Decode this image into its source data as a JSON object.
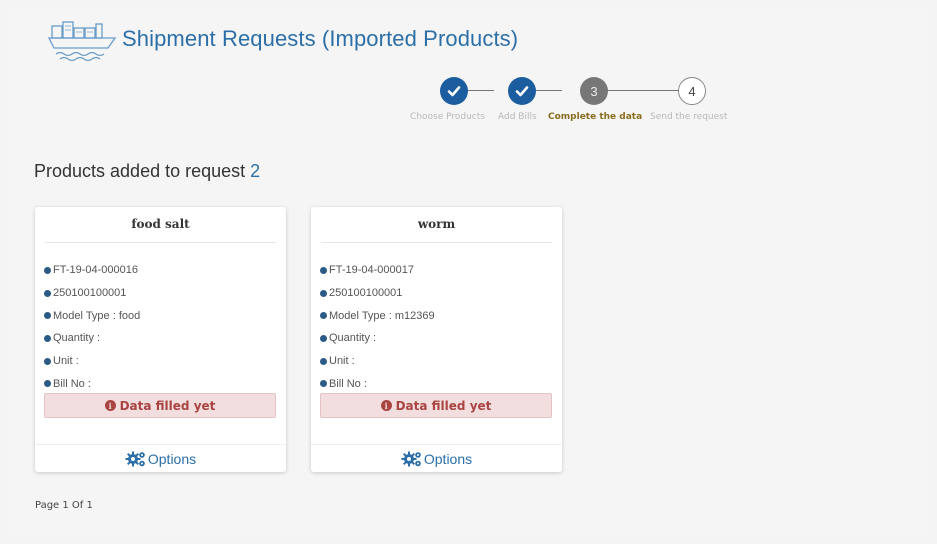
{
  "page": {
    "title": "Shipment Requests (Imported Products)",
    "icon": "ship-icon"
  },
  "wizard": {
    "steps": [
      {
        "number": "",
        "label": "Choose Products",
        "state": "done"
      },
      {
        "number": "",
        "label": "Add Bills",
        "state": "done"
      },
      {
        "number": "3",
        "label": "Complete the data",
        "state": "current"
      },
      {
        "number": "4",
        "label": "Send the request",
        "state": "todo"
      }
    ]
  },
  "products": {
    "heading": "Products added to request",
    "count": "2",
    "items": [
      {
        "name": "food salt",
        "code": "FT-19-04-000016",
        "number": "250100100001",
        "model": "Model Type : food",
        "quantity": "Quantity :",
        "unit": "Unit :",
        "bill": "Bill No :",
        "status": "Data filled yet",
        "options": "Options"
      },
      {
        "name": "worm",
        "code": "FT-19-04-000017",
        "number": "250100100001",
        "model": "Model Type : m12369",
        "quantity": "Quantity :",
        "unit": "Unit :",
        "bill": "Bill No :",
        "status": "Data filled yet",
        "options": "Options"
      }
    ]
  },
  "pagination": {
    "text": "Page 1 Of 1"
  },
  "colors": {
    "accent": "#2c6fa8",
    "step_done": "#1b5d9f",
    "step_current": "#777777",
    "status_bg": "#f2dede",
    "status_text": "#a94442"
  }
}
